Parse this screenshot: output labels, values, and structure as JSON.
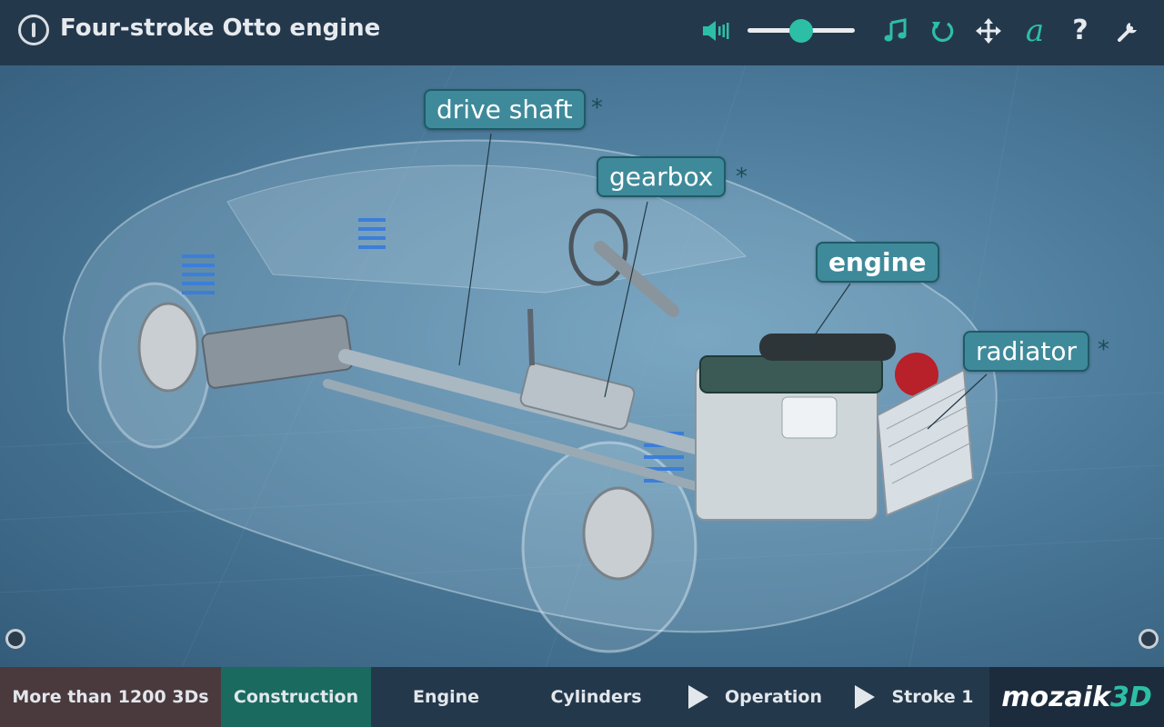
{
  "header": {
    "title": "Four-stroke Otto engine",
    "volume_level_percent": 50
  },
  "labels": {
    "drive_shaft": "drive shaft",
    "gearbox": "gearbox",
    "engine": "engine",
    "radiator": "radiator",
    "star": "*"
  },
  "bottom_nav": {
    "more": "More than 1200 3Ds",
    "construction": "Construction",
    "engine": "Engine",
    "cylinders": "Cylinders",
    "operation": "Operation",
    "stroke": "Stroke 1"
  },
  "brand": {
    "part1": "mozaik",
    "part2": "3D"
  },
  "colors": {
    "accent": "#2dbfa6",
    "bar": "#24384c",
    "active_tab": "#1a6a60",
    "label_bg": "#3e8a9a"
  }
}
